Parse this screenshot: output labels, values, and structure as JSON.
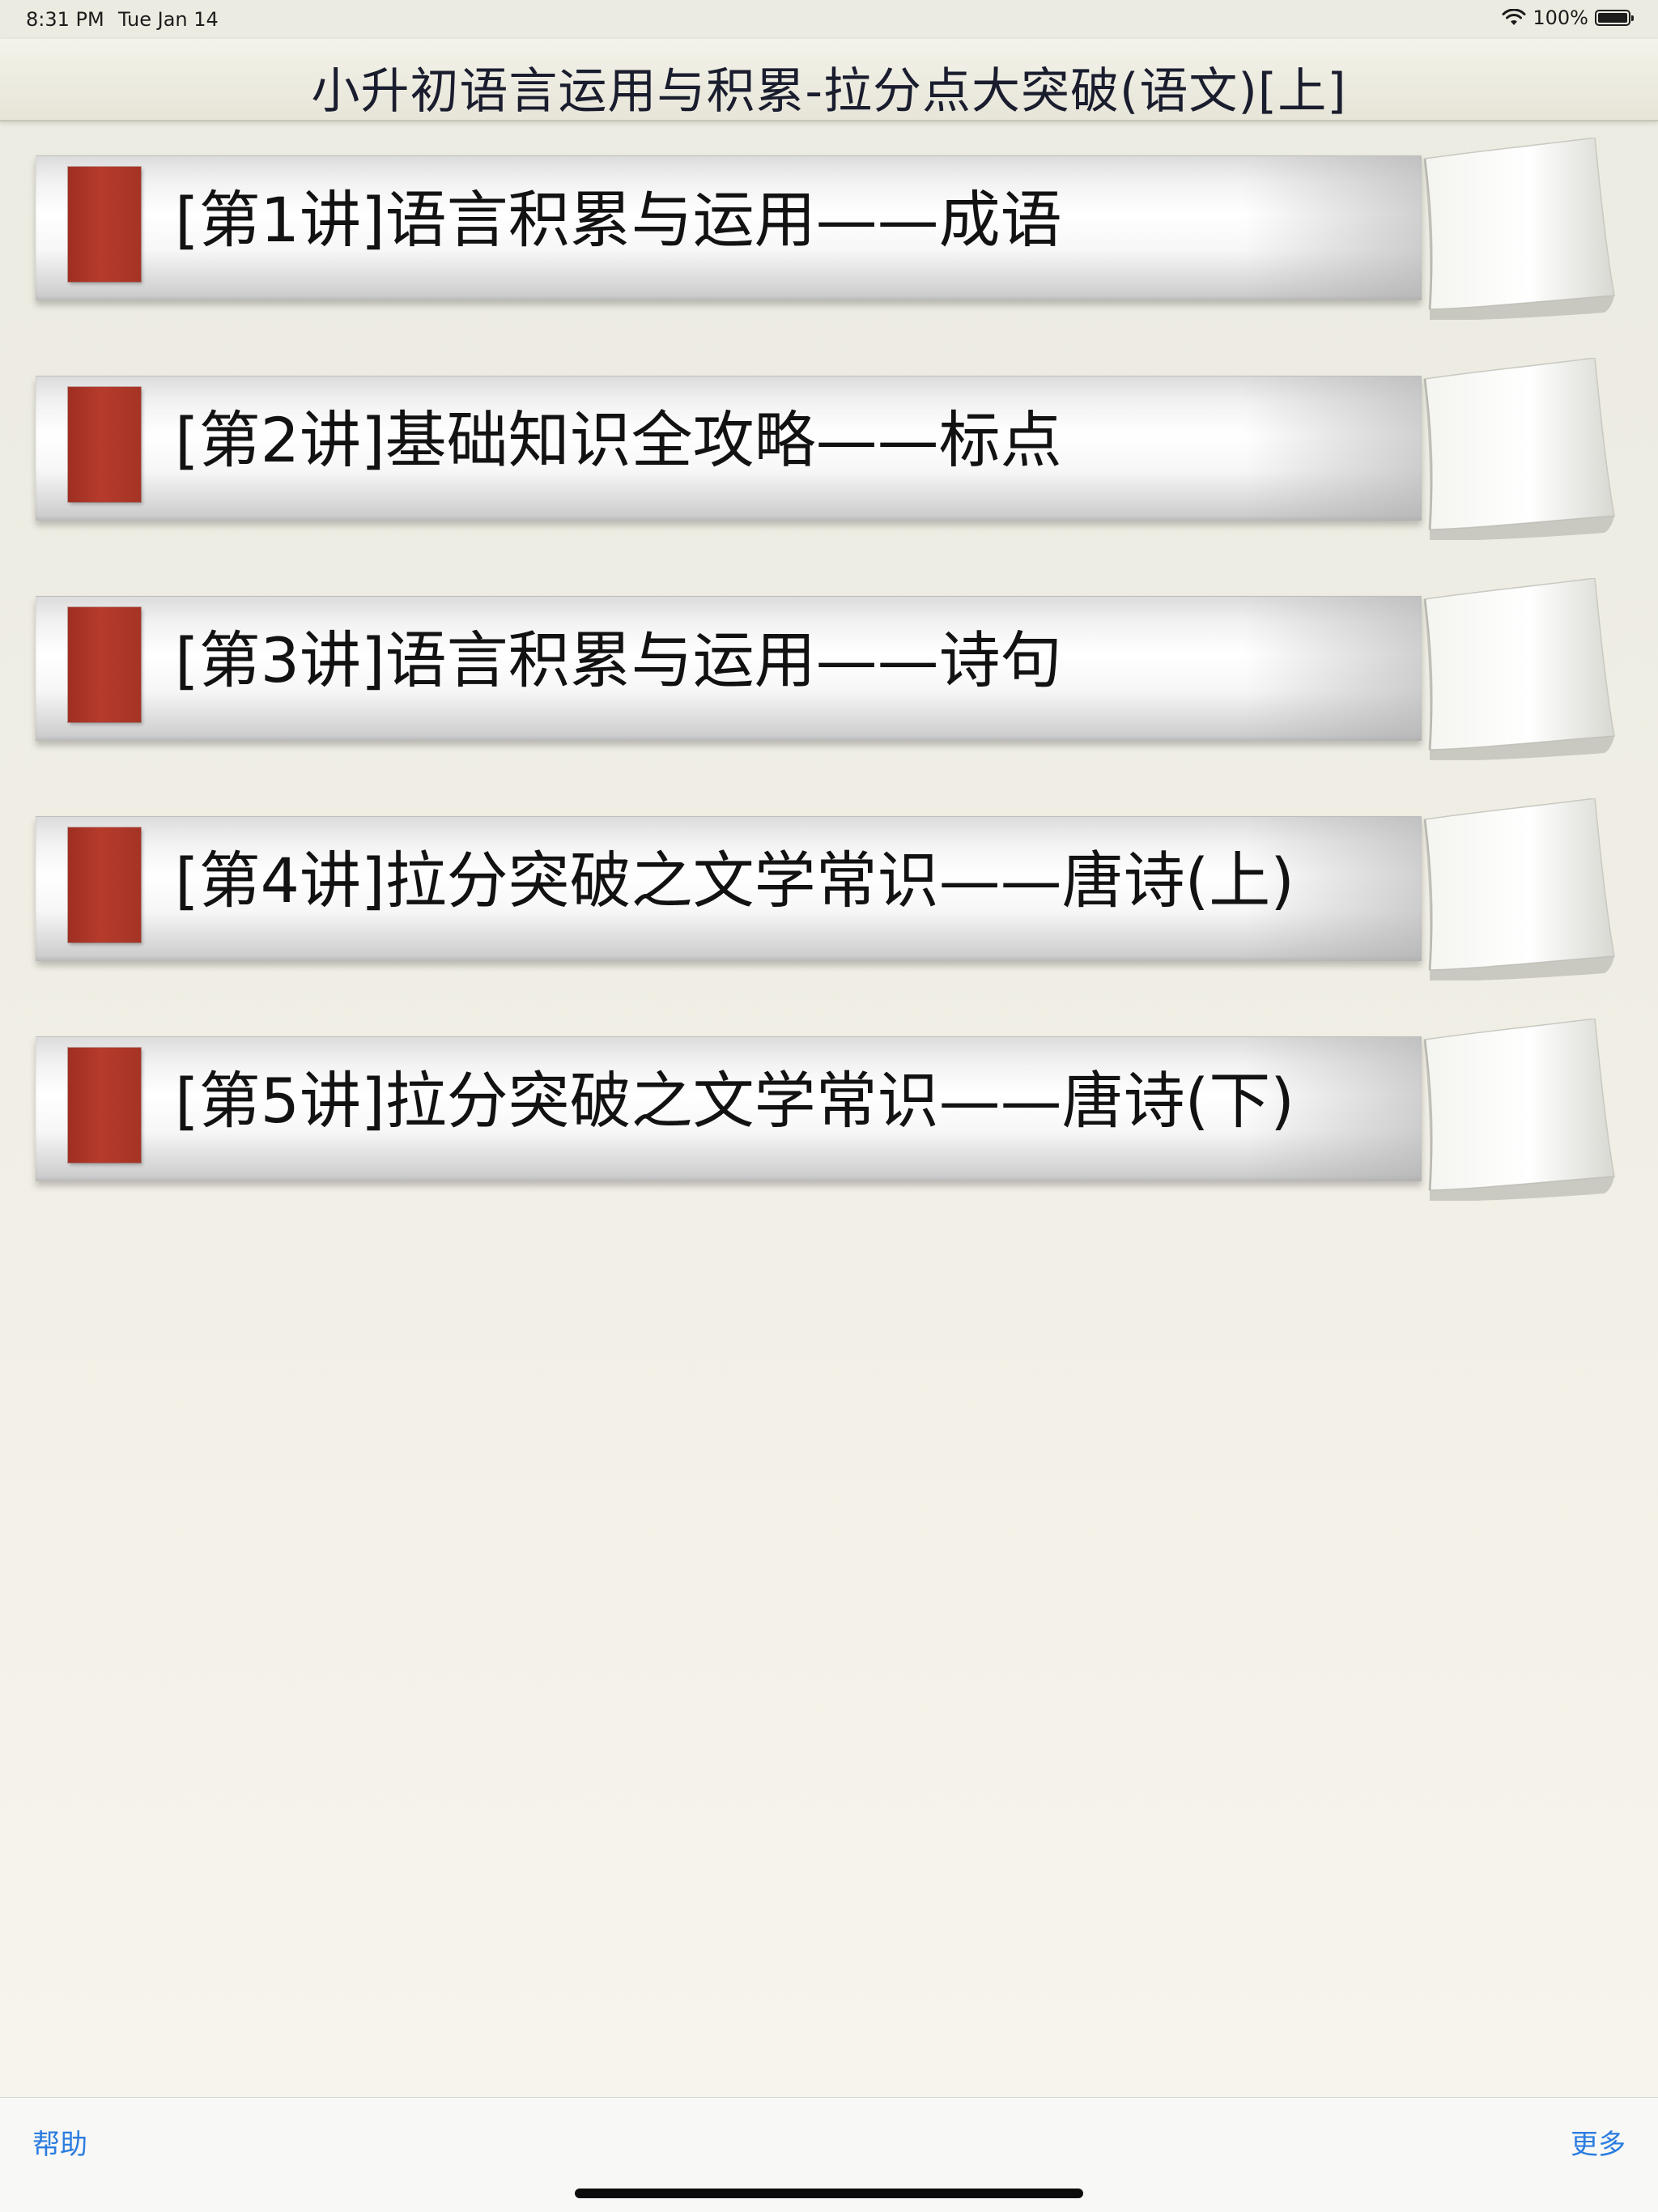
{
  "status_bar": {
    "time": "8:31 PM",
    "date": "Tue Jan 14",
    "battery": "100%",
    "wifi_icon": "wifi-icon",
    "battery_icon": "battery-icon"
  },
  "nav": {
    "title": "小升初语言运用与积累-拉分点大突破(语文)[上]"
  },
  "lectures": [
    {
      "label": "[第1讲]语言积累与运用——成语"
    },
    {
      "label": "[第2讲]基础知识全攻略——标点"
    },
    {
      "label": "[第3讲]语言积累与运用——诗句"
    },
    {
      "label": "[第4讲]拉分突破之文学常识——唐诗(上)"
    },
    {
      "label": "[第5讲]拉分突破之文学常识——唐诗(下)"
    }
  ],
  "toolbar": {
    "help_label": "帮助",
    "more_label": "更多"
  },
  "colors": {
    "accent_red": "#b03a2c",
    "link_blue": "#2b7de0",
    "title_text": "#1a1d2e"
  }
}
